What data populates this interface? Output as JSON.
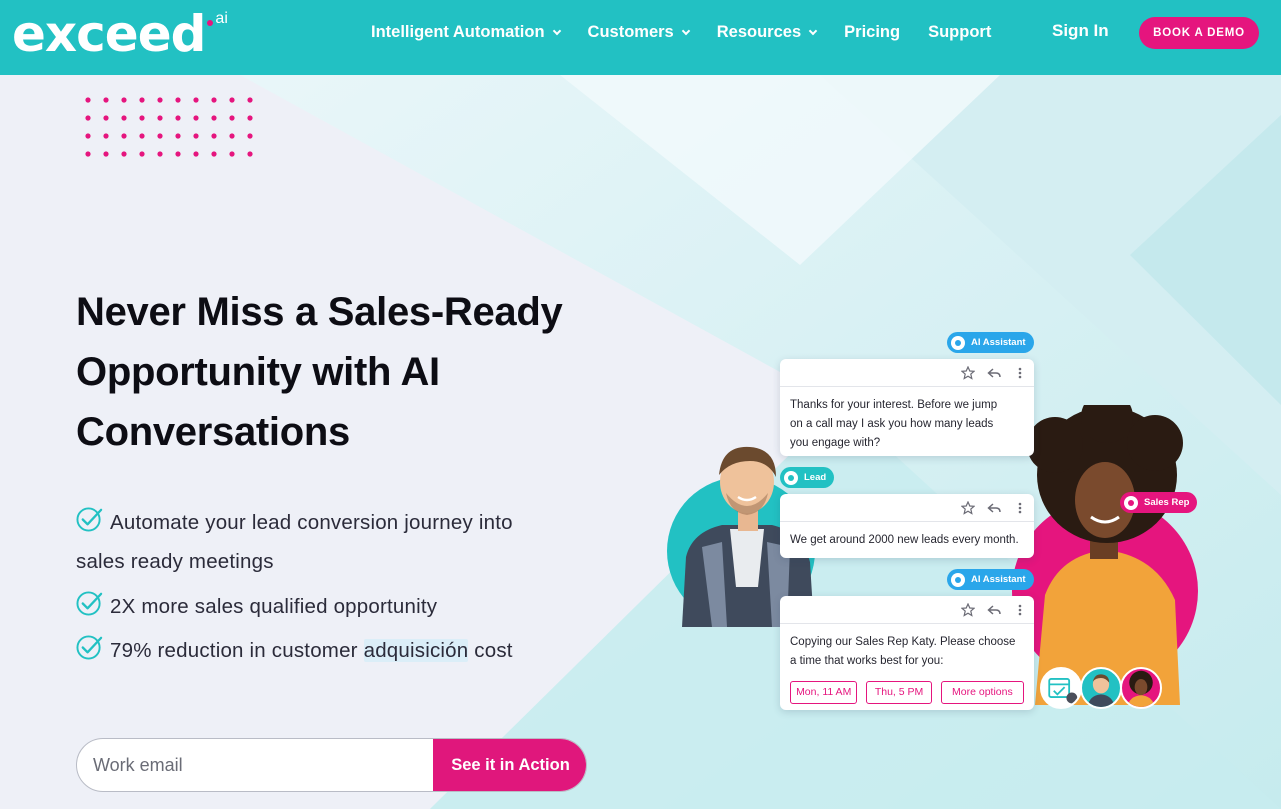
{
  "brand": {
    "logo_text": "exceed",
    "logo_suffix": "ai"
  },
  "nav": {
    "items": [
      {
        "label": "Intelligent Automation",
        "has_dropdown": true
      },
      {
        "label": "Customers",
        "has_dropdown": true
      },
      {
        "label": "Resources",
        "has_dropdown": true
      },
      {
        "label": "Pricing",
        "has_dropdown": false
      },
      {
        "label": "Support",
        "has_dropdown": false
      }
    ],
    "sign_in": "Sign In",
    "book_demo": "BOOK A DEMO"
  },
  "hero": {
    "title_lines": [
      "Never Miss a Sales-Ready",
      "Opportunity with AI",
      "Conversations"
    ],
    "bullets": {
      "b1_line1": "Automate your lead conversion journey into",
      "b1_line2": "sales ready meetings",
      "b2": "2X more sales qualified opportunity",
      "b3_pre": "79% reduction in customer ",
      "b3_hl": "adquisición",
      "b3_post": " cost"
    },
    "email_placeholder": "Work email",
    "cta": "See it in Action"
  },
  "conversation": {
    "pill_ai": "AI Assistant",
    "pill_lead": "Lead",
    "pill_rep": "Sales Rep",
    "msg1": [
      "Thanks for your interest. Before we jump",
      "on a call may I ask you how many leads",
      "you engage with?"
    ],
    "msg2": "We get around 2000 new leads every month.",
    "msg3": [
      "Copying our Sales Rep Katy. Please choose",
      "a time that works best for you:"
    ],
    "options": [
      "Mon, 11 AM",
      "Thu, 5 PM",
      "More options"
    ]
  },
  "colors": {
    "header_teal": "#22c1c3",
    "accent_pink": "#e5157e",
    "ai_blue": "#2aa6ea"
  },
  "icons": [
    "chevron-down-icon",
    "check-circle-icon",
    "star-icon",
    "reply-icon",
    "more-vertical-icon",
    "robot-icon",
    "user-icon",
    "calendar-check-icon"
  ]
}
